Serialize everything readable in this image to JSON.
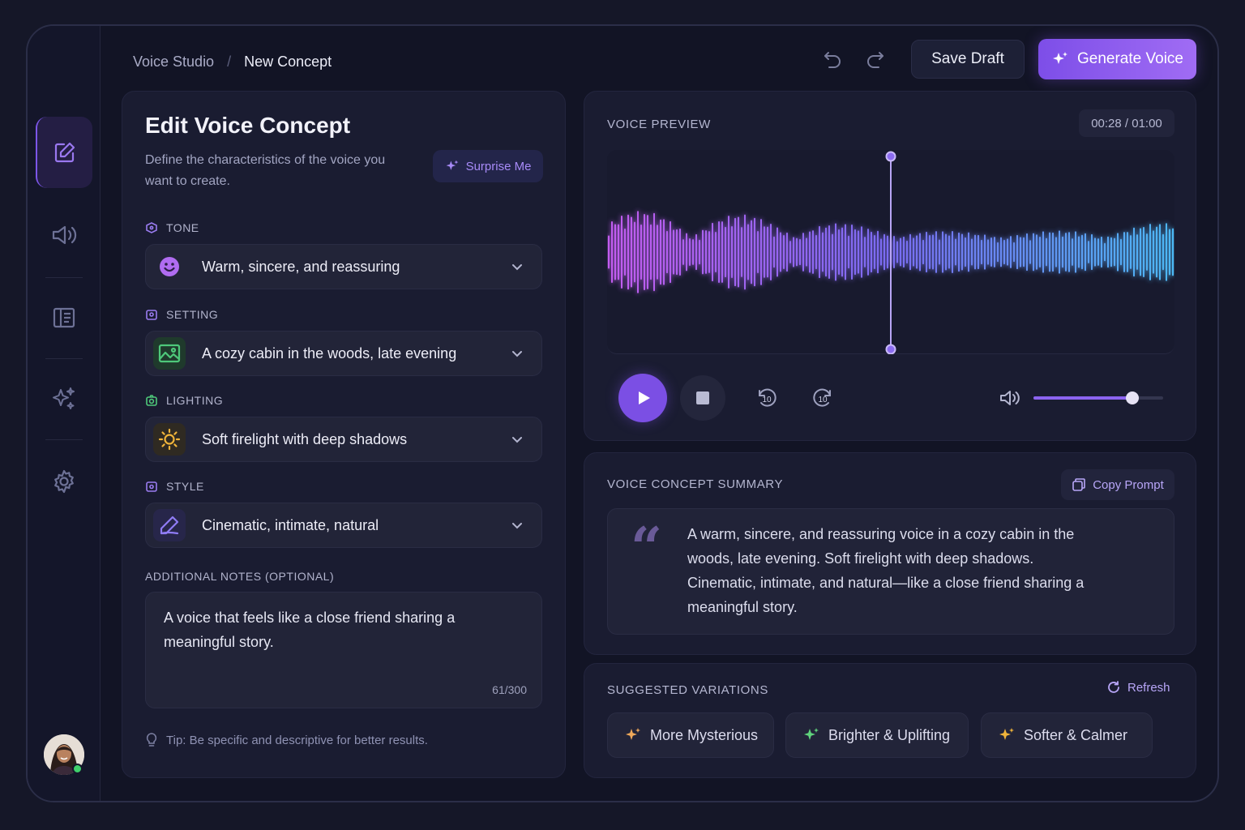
{
  "breadcrumb": {
    "parent": "Voice Studio",
    "separator": "/",
    "current": "New Concept"
  },
  "header": {
    "save_label": "Save Draft",
    "generate_label": "Generate Voice"
  },
  "sidebar": {
    "items": [
      {
        "name": "edit",
        "icon": "edit-icon",
        "active": true
      },
      {
        "name": "audio",
        "icon": "speaker-icon",
        "active": false
      },
      {
        "name": "library",
        "icon": "library-icon",
        "active": false
      },
      {
        "name": "sparkles",
        "icon": "sparkles-icon",
        "active": false
      },
      {
        "name": "settings",
        "icon": "gear-icon",
        "active": false
      }
    ],
    "user_status": "online"
  },
  "editor": {
    "title": "Edit Voice Concept",
    "description": "Define the characteristics of the voice you want to create.",
    "surprise_label": "Surprise Me",
    "fields": [
      {
        "label": "TONE",
        "value": "Warm, sincere, and reassuring",
        "icon": "smiley-icon",
        "color": "#b06cf0"
      },
      {
        "label": "SETTING",
        "value": "A cozy cabin in the woods, late evening",
        "icon": "landscape-icon",
        "color": "#4ec87a"
      },
      {
        "label": "LIGHTING",
        "value": "Soft firelight with deep shadows",
        "icon": "sun-icon",
        "color": "#f0b43a"
      },
      {
        "label": "STYLE",
        "value": "Cinematic, intimate, natural",
        "icon": "pen-icon",
        "color": "#8f7cf5"
      }
    ],
    "notes_label": "ADDITIONAL NOTES (OPTIONAL)",
    "notes_value": "A voice that feels like a close friend sharing a meaningful story.",
    "notes_counter": "61/300",
    "tip": "Tip: Be specific and descriptive for better results."
  },
  "preview": {
    "title": "VOICE PREVIEW",
    "time": "00:28 / 01:00",
    "playhead_fraction": 0.5,
    "volume_fraction": 0.76,
    "skip_back_seconds": "10",
    "skip_forward_seconds": "10",
    "colors": {
      "wave_start": "#c35cf0",
      "wave_mid": "#7a6cf2",
      "wave_end": "#4cb8f4"
    }
  },
  "summary": {
    "title": "VOICE CONCEPT SUMMARY",
    "copy_label": "Copy Prompt",
    "text": "A warm, sincere, and reassuring voice in a cozy cabin in the woods, late evening. Soft firelight with deep shadows. Cinematic, intimate, and natural—like a close friend sharing a meaningful story."
  },
  "variations": {
    "title": "SUGGESTED VARIATIONS",
    "refresh_label": "Refresh",
    "items": [
      {
        "label": "More Mysterious",
        "color": "#f0a95a"
      },
      {
        "label": "Brighter & Uplifting",
        "color": "#5fd37c"
      },
      {
        "label": "Softer & Calmer",
        "color": "#f0b43a"
      }
    ]
  },
  "theme": {
    "accent": "#7d4ee8",
    "background": "#121425"
  }
}
